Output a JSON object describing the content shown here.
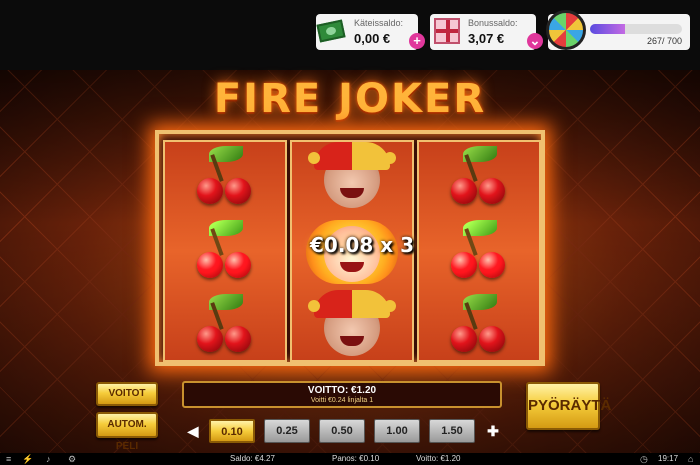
{
  "wallet": {
    "cash_label": "Käteissaldo:",
    "cash_value": "0,00 €",
    "bonus_label": "Bonussaldo:",
    "bonus_value": "3,07 €",
    "progress_text": "267/ 700",
    "progress_fraction": 0.381,
    "plus_symbol": "+"
  },
  "game": {
    "title": "FIRE JOKER",
    "reels": [
      [
        "cherry",
        "cherry",
        "cherry"
      ],
      [
        "joker",
        "joker",
        "joker"
      ],
      [
        "cherry",
        "cherry",
        "cherry"
      ]
    ],
    "win_multiplier_text": "€0.08 x 3"
  },
  "controls": {
    "voitot_label": "VOITOT",
    "autom_label": "AUTOM. PELI",
    "spin_label": "PYÖRÄYTÄ",
    "win_main": "VOITTO:  €1.20",
    "win_sub": "Voitti €0.24 linjalta 1",
    "arrow_left": "◀",
    "arrow_right": "✚",
    "bets": [
      "0.10",
      "0.25",
      "0.50",
      "1.00",
      "1.50"
    ],
    "selected_bet": "0.10"
  },
  "status": {
    "saldo": "Saldo: €4.27",
    "panos": "Panos: €0.10",
    "voitto": "Voitto: €1.20",
    "clock": "19:17"
  },
  "colors": {
    "accent_pink": "#e0379b",
    "gold": "#f6cd3b",
    "fire": "#ff6a10"
  }
}
